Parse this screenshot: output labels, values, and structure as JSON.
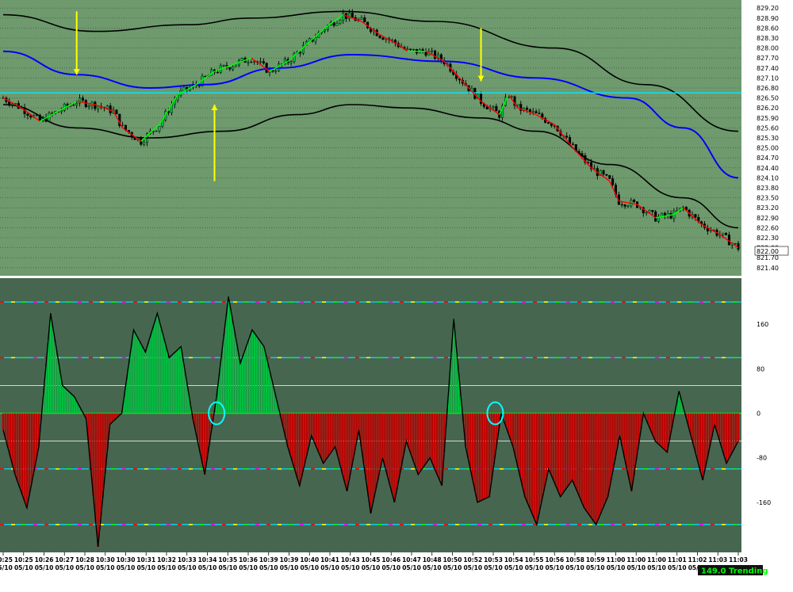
{
  "chart_data": [
    {
      "type": "candlestick",
      "panel": "price",
      "y_axis_side": "right",
      "ylim": [
        821.3,
        829.3
      ],
      "y_ticks": [
        "829.20",
        "828.90",
        "828.60",
        "828.30",
        "828.00",
        "827.70",
        "827.40",
        "827.10",
        "826.80",
        "826.50",
        "826.20",
        "825.90",
        "825.60",
        "825.30",
        "825.00",
        "824.70",
        "824.40",
        "824.10",
        "823.80",
        "823.50",
        "823.20",
        "822.90",
        "822.60",
        "822.30",
        "822.00",
        "821.70",
        "821.40"
      ],
      "last_price": "822.00",
      "close_path": [
        [
          0,
          826.5
        ],
        [
          2,
          826.2
        ],
        [
          4,
          825.8
        ],
        [
          6,
          826.1
        ],
        [
          8,
          826.4
        ],
        [
          10,
          826.3
        ],
        [
          12,
          826.1
        ],
        [
          13,
          825.6
        ],
        [
          15,
          825.2
        ],
        [
          17,
          825.7
        ],
        [
          19,
          826.6
        ],
        [
          21,
          826.9
        ],
        [
          23,
          827.3
        ],
        [
          25,
          827.5
        ],
        [
          27,
          827.7
        ],
        [
          29,
          827.3
        ],
        [
          31,
          827.6
        ],
        [
          33,
          828.1
        ],
        [
          35,
          828.6
        ],
        [
          37,
          829.0
        ],
        [
          39,
          828.8
        ],
        [
          41,
          828.4
        ],
        [
          43,
          828.1
        ],
        [
          44,
          827.9
        ],
        [
          46,
          827.9
        ],
        [
          48,
          827.6
        ],
        [
          50,
          827.0
        ],
        [
          52,
          826.4
        ],
        [
          54,
          826.0
        ],
        [
          55,
          826.6
        ],
        [
          56,
          826.2
        ],
        [
          58,
          826.0
        ],
        [
          60,
          825.7
        ],
        [
          62,
          825.0
        ],
        [
          64,
          824.4
        ],
        [
          66,
          824.0
        ],
        [
          67,
          823.4
        ],
        [
          69,
          823.3
        ],
        [
          71,
          822.9
        ],
        [
          73,
          823.0
        ],
        [
          74,
          823.2
        ],
        [
          76,
          822.7
        ],
        [
          78,
          822.4
        ],
        [
          80,
          822.0
        ]
      ],
      "series": [
        {
          "name": "",
          "role": "upper-band",
          "color": "#000000",
          "points": [
            [
              0,
              829.0
            ],
            [
              10,
              828.5
            ],
            [
              20,
              828.7
            ],
            [
              27,
              828.9
            ],
            [
              37,
              829.1
            ],
            [
              47,
              828.8
            ],
            [
              60,
              828.0
            ],
            [
              70,
              826.9
            ],
            [
              80,
              825.5
            ]
          ]
        },
        {
          "name": "",
          "role": "middle-band",
          "color": "#0000ff",
          "points": [
            [
              0,
              827.9
            ],
            [
              8,
              827.2
            ],
            [
              16,
              826.8
            ],
            [
              22,
              826.9
            ],
            [
              30,
              827.4
            ],
            [
              38,
              827.8
            ],
            [
              48,
              827.6
            ],
            [
              58,
              827.1
            ],
            [
              68,
              826.5
            ],
            [
              74,
              825.6
            ],
            [
              80,
              824.1
            ]
          ]
        },
        {
          "name": "",
          "role": "lower-band",
          "color": "#000000",
          "points": [
            [
              0,
              826.3
            ],
            [
              8,
              825.6
            ],
            [
              16,
              825.3
            ],
            [
              24,
              825.5
            ],
            [
              32,
              826.0
            ],
            [
              38,
              826.3
            ],
            [
              44,
              826.2
            ],
            [
              52,
              825.9
            ],
            [
              58,
              825.5
            ],
            [
              66,
              824.5
            ],
            [
              74,
              823.5
            ],
            [
              80,
              822.6
            ]
          ]
        },
        {
          "name": "",
          "role": "horizontal-level",
          "color": "#00e5ff",
          "y": 826.65
        }
      ],
      "annotations": [
        {
          "type": "arrow-down",
          "color": "#ffff00",
          "x": 8,
          "y_from": 829.1,
          "y_to": 827.2
        },
        {
          "type": "arrow-up",
          "color": "#ffff00",
          "x": 23,
          "y_from": 824.0,
          "y_to": 826.3
        },
        {
          "type": "arrow-down",
          "color": "#ffff00",
          "x": 52,
          "y_from": 828.6,
          "y_to": 827.0
        }
      ]
    },
    {
      "type": "area",
      "panel": "oscillator",
      "y_axis_side": "right",
      "ylim": [
        -250,
        240
      ],
      "y_ticks": [
        160,
        80,
        0,
        -80,
        -160
      ],
      "levels": [
        {
          "value": 200,
          "style": "dashed-multicolor"
        },
        {
          "value": 100,
          "style": "dashed-multicolor"
        },
        {
          "value": 50,
          "color": "#ffffff"
        },
        {
          "value": -50,
          "color": "#ffffff"
        },
        {
          "value": -100,
          "style": "dashed-multicolor"
        },
        {
          "value": -200,
          "style": "dashed-multicolor"
        }
      ],
      "series": [
        {
          "name": "",
          "colors": {
            "positive": "#00c040",
            "negative": "#c00000",
            "neutral": "#555555"
          },
          "values": [
            [
              0,
              -30
            ],
            [
              2,
              -110
            ],
            [
              4,
              -170
            ],
            [
              6,
              -60
            ],
            [
              8,
              180
            ],
            [
              10,
              50
            ],
            [
              12,
              30
            ],
            [
              14,
              -10
            ],
            [
              16,
              -240
            ],
            [
              18,
              -20
            ],
            [
              20,
              0
            ],
            [
              22,
              150
            ],
            [
              24,
              110
            ],
            [
              26,
              180
            ],
            [
              28,
              100
            ],
            [
              30,
              120
            ],
            [
              32,
              -10
            ],
            [
              34,
              -110
            ],
            [
              36,
              30
            ],
            [
              38,
              210
            ],
            [
              40,
              90
            ],
            [
              42,
              150
            ],
            [
              44,
              120
            ],
            [
              46,
              30
            ],
            [
              48,
              -60
            ],
            [
              50,
              -130
            ],
            [
              52,
              -40
            ],
            [
              54,
              -90
            ],
            [
              56,
              -60
            ],
            [
              58,
              -140
            ],
            [
              60,
              -30
            ],
            [
              62,
              -180
            ],
            [
              64,
              -80
            ],
            [
              66,
              -160
            ],
            [
              68,
              -50
            ],
            [
              70,
              -110
            ],
            [
              72,
              -80
            ],
            [
              74,
              -130
            ],
            [
              76,
              170
            ],
            [
              78,
              -60
            ],
            [
              80,
              -160
            ],
            [
              82,
              -150
            ],
            [
              84,
              0
            ],
            [
              86,
              -60
            ],
            [
              88,
              -150
            ],
            [
              90,
              -200
            ],
            [
              92,
              -100
            ],
            [
              94,
              -150
            ],
            [
              96,
              -120
            ],
            [
              98,
              -170
            ],
            [
              100,
              -200
            ],
            [
              102,
              -150
            ],
            [
              104,
              -40
            ],
            [
              106,
              -140
            ],
            [
              108,
              0
            ],
            [
              110,
              -50
            ],
            [
              112,
              -70
            ],
            [
              114,
              40
            ],
            [
              116,
              -40
            ],
            [
              118,
              -120
            ],
            [
              120,
              -20
            ],
            [
              122,
              -90
            ],
            [
              124,
              -50
            ]
          ]
        }
      ],
      "annotations": [
        {
          "type": "circle",
          "color": "#00ffff",
          "x": 36,
          "y": 0
        },
        {
          "type": "circle",
          "color": "#00ffff",
          "x": 83,
          "y": 0
        }
      ],
      "x_tick_labels": [
        {
          "time": "10:25",
          "date": "05/10"
        },
        {
          "time": "10:25",
          "date": "05/10"
        },
        {
          "time": "10:26",
          "date": "05/10"
        },
        {
          "time": "10:27",
          "date": "05/10"
        },
        {
          "time": "10:28",
          "date": "05/10"
        },
        {
          "time": "10:30",
          "date": "05/10"
        },
        {
          "time": "10:30",
          "date": "05/10"
        },
        {
          "time": "10:31",
          "date": "05/10"
        },
        {
          "time": "10:32",
          "date": "05/10"
        },
        {
          "time": "10:33",
          "date": "05/10"
        },
        {
          "time": "10:34",
          "date": "05/10"
        },
        {
          "time": "10:35",
          "date": "05/10"
        },
        {
          "time": "10:36",
          "date": "05/10"
        },
        {
          "time": "10:39",
          "date": "05/10"
        },
        {
          "time": "10:39",
          "date": "05/10"
        },
        {
          "time": "10:40",
          "date": "05/10"
        },
        {
          "time": "10:41",
          "date": "05/10"
        },
        {
          "time": "10:43",
          "date": "05/10"
        },
        {
          "time": "10:45",
          "date": "05/10"
        },
        {
          "time": "10:46",
          "date": "05/10"
        },
        {
          "time": "10:47",
          "date": "05/10"
        },
        {
          "time": "10:48",
          "date": "05/10"
        },
        {
          "time": "10:50",
          "date": "05/10"
        },
        {
          "time": "10:52",
          "date": "05/10"
        },
        {
          "time": "10:53",
          "date": "05/10"
        },
        {
          "time": "10:54",
          "date": "05/10"
        },
        {
          "time": "10:55",
          "date": "05/10"
        },
        {
          "time": "10:56",
          "date": "05/10"
        },
        {
          "time": "10:58",
          "date": "05/10"
        },
        {
          "time": "10:59",
          "date": "05/10"
        },
        {
          "time": "11:00",
          "date": "05/10"
        },
        {
          "time": "11:00",
          "date": "05/10"
        },
        {
          "time": "11:00",
          "date": "05/10"
        },
        {
          "time": "11:01",
          "date": "05/10"
        },
        {
          "time": "11:02",
          "date": "05/10"
        },
        {
          "time": "11:03",
          "date": "05/10"
        },
        {
          "time": "11:03",
          "date": "05/10"
        }
      ],
      "status_label": "149.0 Trending",
      "status_color": "#00ff00"
    }
  ],
  "colors": {
    "price_background": "#6e9a6e",
    "oscillator_background": "#47664f",
    "bull_candle": "#00c040",
    "bear_candle": "#000000",
    "overlay_up": "#00ff00",
    "overlay_down": "#ff0000"
  }
}
